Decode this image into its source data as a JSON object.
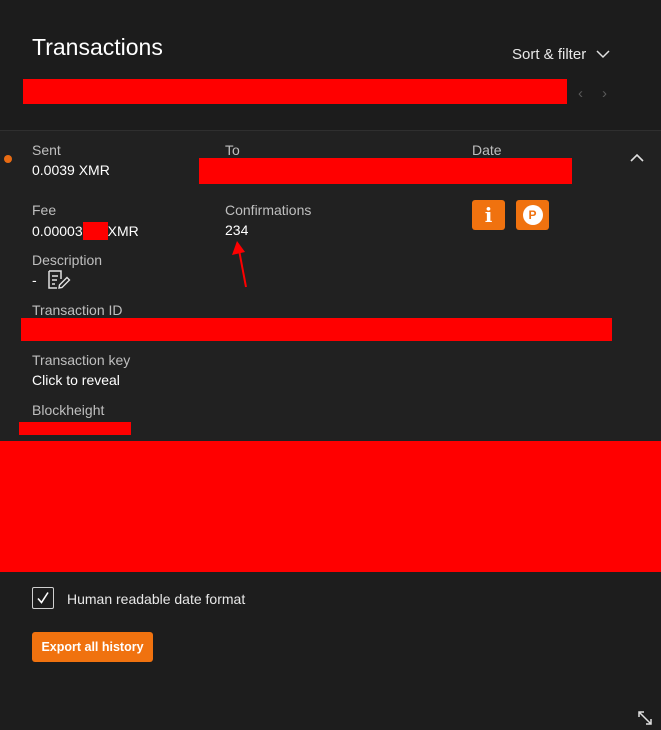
{
  "header": {
    "title": "Transactions",
    "sort_filter_label": "Sort & filter",
    "prev_glyph": "‹",
    "next_glyph": "›"
  },
  "transaction": {
    "status_color": "#e86b13",
    "sent_label": "Sent",
    "sent_value": "0.0039 XMR",
    "to_label": "To",
    "date_label": "Date",
    "fee_label": "Fee",
    "fee_prefix": "0.00003",
    "fee_suffix": "XMR",
    "confirmations_label": "Confirmations",
    "confirmations_value": "234",
    "description_label": "Description",
    "description_value": "-",
    "txid_label": "Transaction ID",
    "txkey_label": "Transaction key",
    "txkey_value": "Click to reveal",
    "blockheight_label": "Blockheight",
    "info_glyph": "i",
    "payment_proof_glyph": "P"
  },
  "footer": {
    "human_readable_label": "Human readable date format",
    "human_readable_checked": true,
    "export_label": "Export all history"
  },
  "colors": {
    "accent": "#f0720f",
    "redaction": "#ff0000",
    "annotation_arrow": "#ff0000",
    "background": "#1c1c1c"
  },
  "icons": [
    "chevron-down-icon",
    "chevron-left-icon",
    "chevron-right-icon",
    "chevron-up-icon",
    "edit-note-icon",
    "info-icon",
    "payment-proof-icon",
    "checkmark-icon",
    "resize-icon"
  ]
}
